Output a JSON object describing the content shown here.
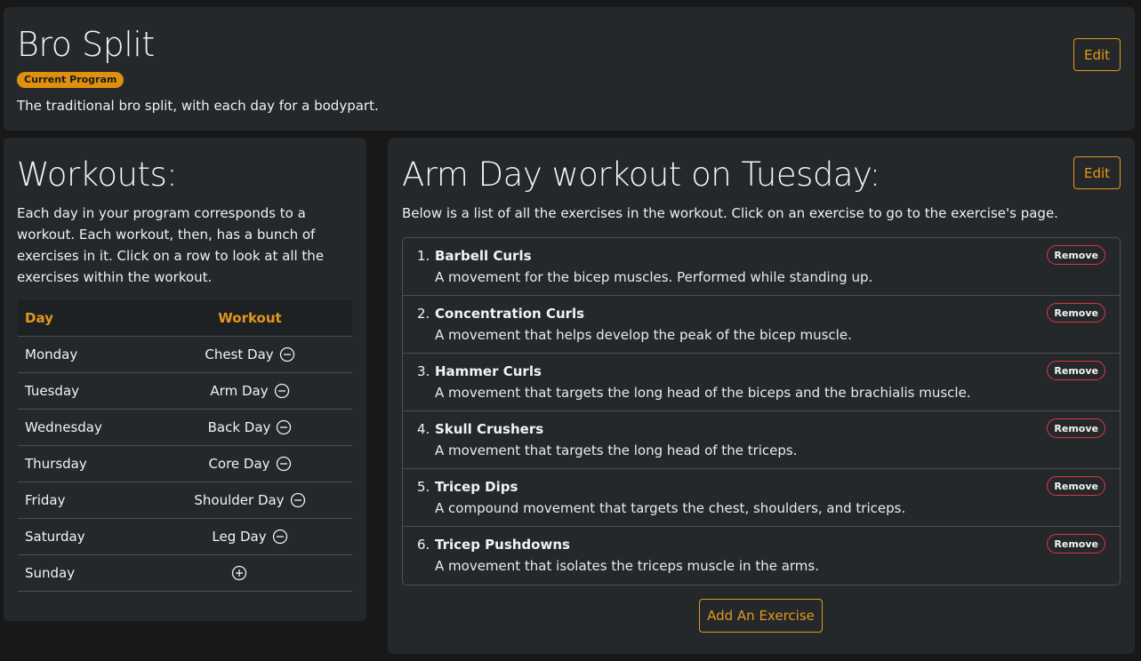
{
  "program": {
    "title": "Bro Split",
    "badge": "Current Program",
    "description": "The traditional bro split, with each day for a bodypart.",
    "edit_label": "Edit"
  },
  "workouts": {
    "title": "Workouts:",
    "description": "Each day in your program corresponds to a workout. Each workout, then, has a bunch of exercises in it. Click on a row to look at all the exercises within the workout.",
    "columns": {
      "day": "Day",
      "workout": "Workout"
    },
    "rows": [
      {
        "day": "Monday",
        "workout": "Chest Day",
        "icon": "minus-circle-icon"
      },
      {
        "day": "Tuesday",
        "workout": "Arm Day",
        "icon": "minus-circle-icon"
      },
      {
        "day": "Wednesday",
        "workout": "Back Day",
        "icon": "minus-circle-icon"
      },
      {
        "day": "Thursday",
        "workout": "Core Day",
        "icon": "minus-circle-icon"
      },
      {
        "day": "Friday",
        "workout": "Shoulder Day",
        "icon": "minus-circle-icon"
      },
      {
        "day": "Saturday",
        "workout": "Leg Day",
        "icon": "minus-circle-icon"
      },
      {
        "day": "Sunday",
        "workout": "",
        "icon": "plus-circle-icon"
      }
    ]
  },
  "detail": {
    "title": "Arm Day workout on Tuesday:",
    "edit_label": "Edit",
    "description": "Below is a list of all the exercises in the workout. Click on an exercise to go to the exercise's page.",
    "remove_label": "Remove",
    "add_label": "Add An Exercise",
    "exercises": [
      {
        "num": "1.",
        "name": "Barbell Curls",
        "desc": "A movement for the bicep muscles. Performed while standing up."
      },
      {
        "num": "2.",
        "name": "Concentration Curls",
        "desc": "A movement that helps develop the peak of the bicep muscle."
      },
      {
        "num": "3.",
        "name": "Hammer Curls",
        "desc": "A movement that targets the long head of the biceps and the brachialis muscle."
      },
      {
        "num": "4.",
        "name": "Skull Crushers",
        "desc": "A movement that targets the long head of the triceps."
      },
      {
        "num": "5.",
        "name": "Tricep Dips",
        "desc": "A compound movement that targets the chest, shoulders, and triceps."
      },
      {
        "num": "6.",
        "name": "Tricep Pushdowns",
        "desc": "A movement that isolates the triceps muscle in the arms."
      }
    ]
  },
  "colors": {
    "accent": "#e3981a",
    "danger": "#dc3545",
    "panel": "#25282b",
    "background": "#181818"
  }
}
